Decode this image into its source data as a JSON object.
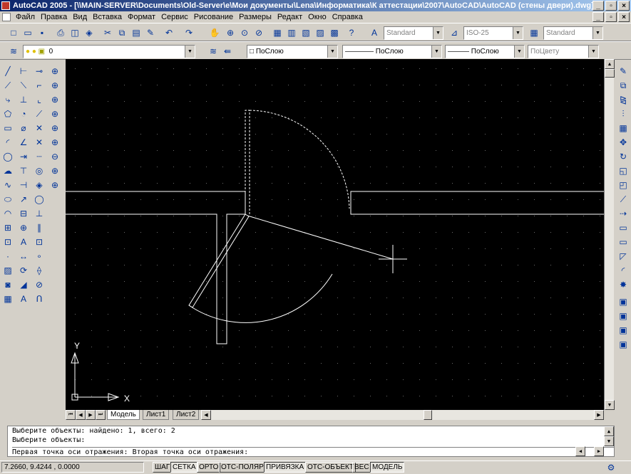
{
  "window": {
    "title": "AutoCAD 2005 - [\\\\MAIN-SERVER\\Documents\\Old-Server\\e\\Мои документы\\Lena\\Информатика\\К аттестации\\2007\\AutoCAD\\AutoCAD (стены двери).dwg]",
    "min_label": "_",
    "max_label": "▫",
    "close_label": "×"
  },
  "menu": [
    "Файл",
    "Правка",
    "Вид",
    "Вставка",
    "Формат",
    "Сервис",
    "Рисование",
    "Размеры",
    "Редакт",
    "Окно",
    "Справка"
  ],
  "styles": {
    "text_style": "Standard",
    "dim_style": "ISO-25",
    "table_style": "Standard"
  },
  "layers": {
    "current_layer": "0",
    "color": "ПоСлою",
    "linetype": "ПоСлою",
    "lineweight": "ПоСлою",
    "plotstyle": "ПоЦвету"
  },
  "tabs": [
    {
      "label": "Модель",
      "active": true
    },
    {
      "label": "Лист1",
      "active": false
    },
    {
      "label": "Лист2",
      "active": false
    }
  ],
  "ucs": {
    "x_label": "X",
    "y_label": "Y"
  },
  "command": {
    "lines": [
      "Выберите объекты: найдено: 1, всего: 2",
      "Выберите объекты:",
      "Первая точка оси отражения: Вторая точка оси отражения:"
    ]
  },
  "status": {
    "coords": "7.2660, 9.4244 , 0.0000",
    "buttons": [
      {
        "label": "ШАГ",
        "on": false
      },
      {
        "label": "СЕТКА",
        "on": true
      },
      {
        "label": "ОРТО",
        "on": false
      },
      {
        "label": "ОТС-ПОЛЯР",
        "on": false
      },
      {
        "label": "ПРИВЯЗКА",
        "on": true
      },
      {
        "label": "ОТС-ОБЪЕКТ",
        "on": false
      },
      {
        "label": "ВЕС",
        "on": false
      },
      {
        "label": "МОДЕЛЬ",
        "on": true
      }
    ]
  },
  "colors": {
    "title_start": "#0a246a",
    "title_end": "#a6caf0",
    "canvas": "#000000",
    "drawing": "#ffffff"
  }
}
